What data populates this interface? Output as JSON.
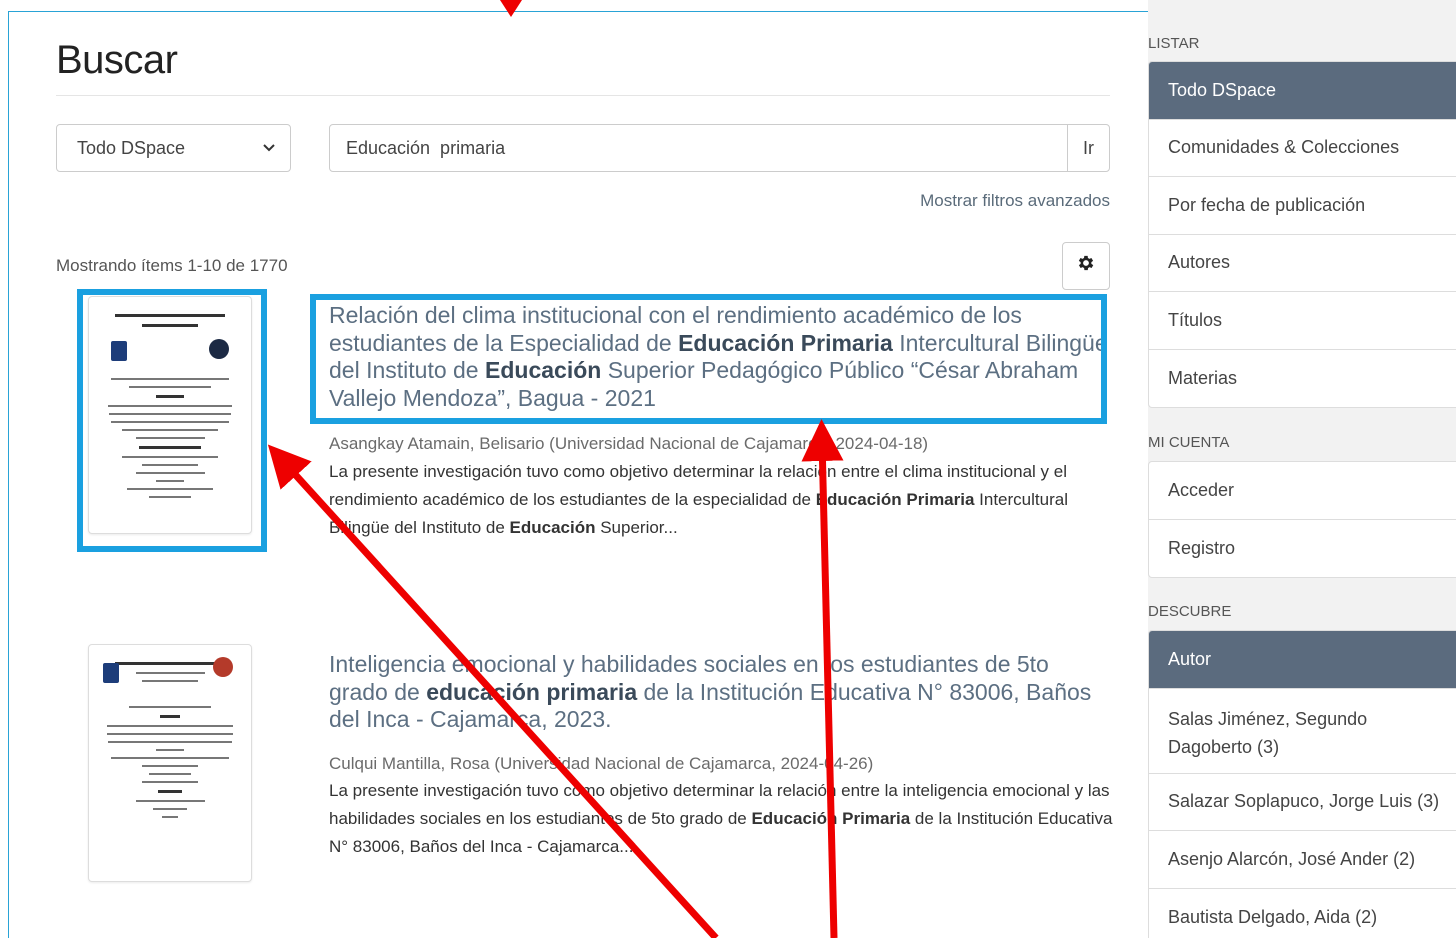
{
  "page": {
    "title": "Buscar",
    "scope_value": "Todo DSpace",
    "search_value": "Educación  primaria",
    "go_label": "Ir",
    "advanced_filters_label": "Mostrar filtros avanzados",
    "results_count": "Mostrando ítems 1-10 de 1770"
  },
  "results": [
    {
      "title_parts": [
        "Relación del clima institucional con el rendimiento académico de los estudiantes de la Especialidad de ",
        "Educación Primaria",
        " Intercultural Bilingüe del Instituto de ",
        "Educación",
        " Superior Pedagógico Público “César Abraham Vallejo Mendoza”, Bagua - 2021"
      ],
      "meta": "Asangkay Atamain, Belisario (Universidad Nacional de Cajamarca, 2024-04-18)",
      "abstract_parts": [
        "La presente investigación tuvo como objetivo determinar la relación entre el clima institucional y el rendimiento académico de los estudiantes de la especialidad de ",
        "Educación Primaria",
        " Intercultural Bilingüe del Instituto de ",
        "Educación",
        " Superior..."
      ]
    },
    {
      "title_parts": [
        "Inteligencia emocional y habilidades sociales en los estudiantes de 5to grado de ",
        "educación primaria",
        " de la Institución Educativa N° 83006, Baños del Inca - Cajamarca, 2023."
      ],
      "meta": "Culqui Mantilla, Rosa (Universidad Nacional de Cajamarca, 2024-04-26)",
      "abstract_parts": [
        "La presente investigación tuvo como objetivo determinar la relación entre la inteligencia emocional y las habilidades sociales en los estudiantes de 5to grado de ",
        "Educación Primaria",
        " de la Institución Educativa N° 83006, Baños del Inca - Cajamarca..."
      ]
    }
  ],
  "sidebar": {
    "listar_heading": "LISTAR",
    "listar_items": [
      "Todo DSpace",
      "Comunidades & Colecciones",
      "Por fecha de publicación",
      "Autores",
      "Títulos",
      "Materias"
    ],
    "cuenta_heading": "MI CUENTA",
    "cuenta_items": [
      "Acceder",
      "Registro"
    ],
    "descubre_heading": "DESCUBRE",
    "descubre_active": "Autor",
    "descubre_items": [
      "Salas Jiménez, Segundo Dagoberto (3)",
      "Salazar Soplapuco, Jorge Luis (3)",
      "Asenjo Alarcón, José Ander (2)",
      "Bautista Delgado, Aida (2)"
    ]
  },
  "colors": {
    "highlight_box": "#1aa0e0",
    "arrow": "#ee0000",
    "sidebar_active": "#5b6b7e",
    "frame": "#29a3d6"
  }
}
